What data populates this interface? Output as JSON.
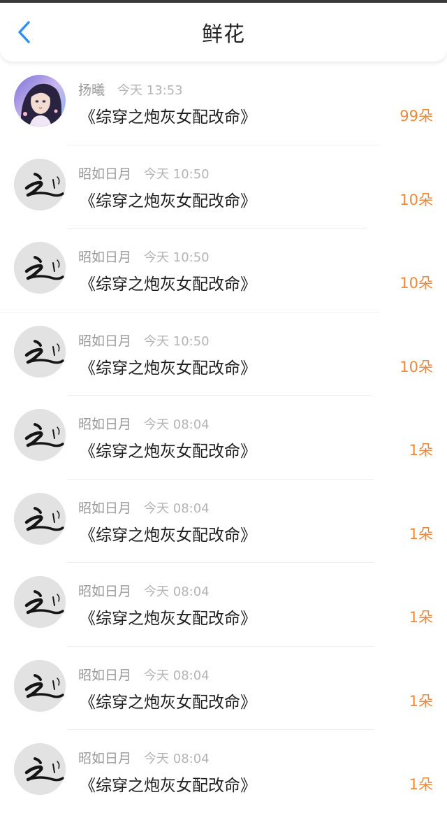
{
  "header": {
    "title": "鲜花",
    "back_icon": "chevron-left-icon",
    "accent": "#2f8ff0"
  },
  "colors": {
    "count": "#f0883a",
    "name": "#9a9a9a",
    "book": "#1f1f1f"
  },
  "records": [
    {
      "name": "扬曦",
      "time": "今天 13:53",
      "book": "《综穿之炮灰女配改命》",
      "count": "99朵",
      "avatar": "girl-portrait"
    },
    {
      "name": "昭如日月",
      "time": "今天 10:50",
      "book": "《综穿之炮灰女配改命》",
      "count": "10朵",
      "avatar": "calligraphy-zhi"
    },
    {
      "name": "昭如日月",
      "time": "今天 10:50",
      "book": "《综穿之炮灰女配改命》",
      "count": "10朵",
      "avatar": "calligraphy-zhi"
    },
    {
      "name": "昭如日月",
      "time": "今天 10:50",
      "book": "《综穿之炮灰女配改命》",
      "count": "10朵",
      "avatar": "calligraphy-zhi"
    },
    {
      "name": "昭如日月",
      "time": "今天 08:04",
      "book": "《综穿之炮灰女配改命》",
      "count": "1朵",
      "avatar": "calligraphy-zhi"
    },
    {
      "name": "昭如日月",
      "time": "今天 08:04",
      "book": "《综穿之炮灰女配改命》",
      "count": "1朵",
      "avatar": "calligraphy-zhi"
    },
    {
      "name": "昭如日月",
      "time": "今天 08:04",
      "book": "《综穿之炮灰女配改命》",
      "count": "1朵",
      "avatar": "calligraphy-zhi"
    },
    {
      "name": "昭如日月",
      "time": "今天 08:04",
      "book": "《综穿之炮灰女配改命》",
      "count": "1朵",
      "avatar": "calligraphy-zhi"
    },
    {
      "name": "昭如日月",
      "time": "今天 08:04",
      "book": "《综穿之炮灰女配改命》",
      "count": "1朵",
      "avatar": "calligraphy-zhi"
    }
  ]
}
